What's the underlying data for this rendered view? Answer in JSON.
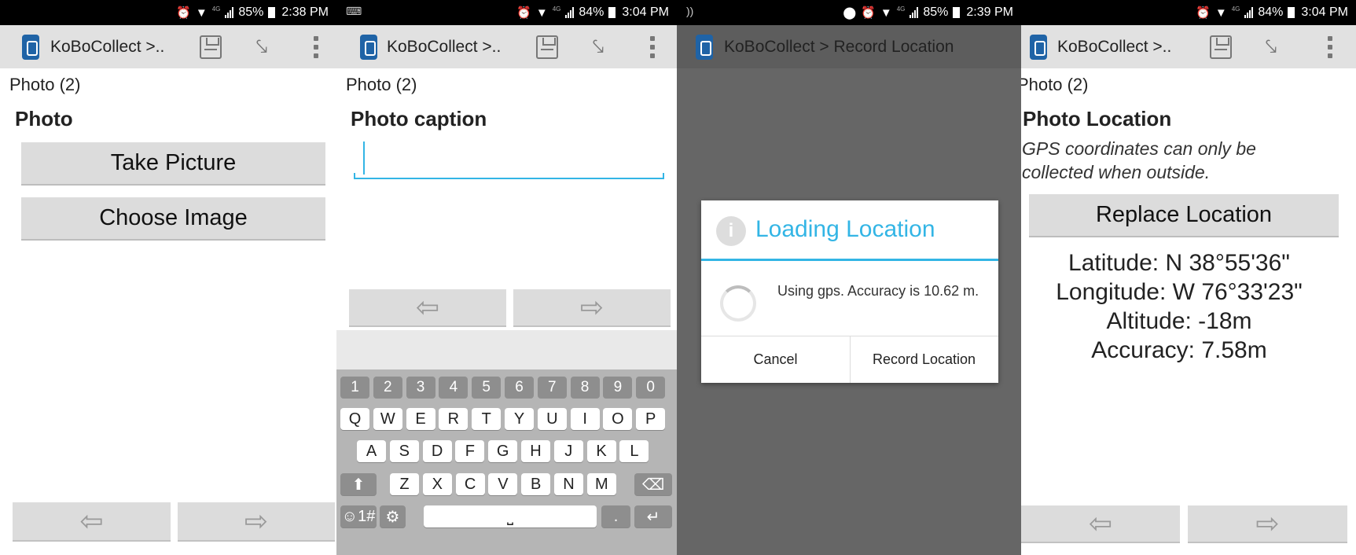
{
  "panels": {
    "p1": {
      "status": {
        "pct": "85%",
        "time": "2:38 PM",
        "net": "4G"
      },
      "app_title": "KoBoCollect >..",
      "group_label": "Photo (2)",
      "question": "Photo",
      "take_picture": "Take Picture",
      "choose_image": "Choose Image",
      "back_arrow": "⇦",
      "forward_arrow": "⇨"
    },
    "p2": {
      "status": {
        "pct": "84%",
        "time": "3:04 PM",
        "net": "4G"
      },
      "app_title": "KoBoCollect >..",
      "group_label": "Photo (2)",
      "question": "Photo caption",
      "caption_value": "",
      "back_arrow": "⇦",
      "forward_arrow": "⇨",
      "keyboard": {
        "numbers": [
          "1",
          "2",
          "3",
          "4",
          "5",
          "6",
          "7",
          "8",
          "9",
          "0"
        ],
        "row1": [
          "Q",
          "W",
          "E",
          "R",
          "T",
          "Y",
          "U",
          "I",
          "O",
          "P"
        ],
        "row2": [
          "A",
          "S",
          "D",
          "F",
          "G",
          "H",
          "J",
          "K",
          "L"
        ],
        "row3": [
          "Z",
          "X",
          "C",
          "V",
          "B",
          "N",
          "M"
        ],
        "symbols_key": "☺1#",
        "settings_key": "⚙",
        "shift_key": "⬆",
        "delete_key": "⌫",
        "space_key": "⎵",
        "period_key": ".",
        "enter_key": "↵"
      }
    },
    "p3": {
      "status": {
        "pct": "85%",
        "time": "2:39 PM",
        "net": "4G"
      },
      "app_title": "KoBoCollect > Record Location",
      "dialog_title": "Loading Location",
      "dialog_info_glyph": "i",
      "dialog_message": "Using gps. Accuracy is 10.62 m.",
      "cancel": "Cancel",
      "record_location": "Record Location"
    },
    "p4": {
      "status": {
        "pct": "84%",
        "time": "3:04 PM",
        "net": "4G"
      },
      "app_title": "KoBoCollect >..",
      "group_label": "Photo (2)",
      "question": "Photo Location",
      "hint": "GPS coordinates can only be collected when outside.",
      "replace_location": "Replace Location",
      "latitude": "Latitude: N 38°55'36\"",
      "longitude": "Longitude: W 76°33'23\"",
      "altitude": "Altitude: -18m",
      "accuracy": "Accuracy: 7.58m",
      "back_arrow": "⇦",
      "forward_arrow": "⇨"
    }
  },
  "icons": {
    "alarm": "⏰",
    "wifi": "▼",
    "location": "⬤",
    "nfc": "))",
    "keyboard": "⌨",
    "jump": "⤥"
  },
  "colors": {
    "accent": "#33b5e5",
    "app_bar": "#e1e1e1",
    "button": "#dcdcdc",
    "brand": "#1f63a6"
  }
}
